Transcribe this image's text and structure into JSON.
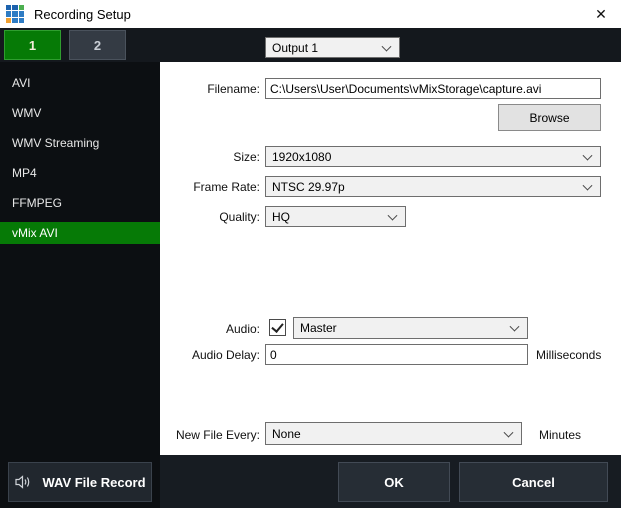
{
  "window": {
    "title": "Recording Setup",
    "close_glyph": "✕"
  },
  "tabs": [
    {
      "label": "1",
      "active": true
    },
    {
      "label": "2",
      "active": false
    }
  ],
  "output_select": {
    "value": "Output 1"
  },
  "sidebar": {
    "items": [
      {
        "label": "AVI",
        "selected": false
      },
      {
        "label": "WMV",
        "selected": false
      },
      {
        "label": "WMV Streaming",
        "selected": false
      },
      {
        "label": "MP4",
        "selected": false
      },
      {
        "label": "FFMPEG",
        "selected": false
      },
      {
        "label": "vMix AVI",
        "selected": true
      }
    ]
  },
  "form": {
    "filename": {
      "label": "Filename:",
      "value": "C:\\Users\\User\\Documents\\vMixStorage\\capture.avi"
    },
    "browse_label": "Browse",
    "size": {
      "label": "Size:",
      "value": "1920x1080"
    },
    "frame_rate": {
      "label": "Frame Rate:",
      "value": "NTSC 29.97p"
    },
    "quality": {
      "label": "Quality:",
      "value": "HQ"
    },
    "audio": {
      "label": "Audio:",
      "checked": true,
      "value": "Master"
    },
    "audio_delay": {
      "label": "Audio Delay:",
      "value": "0",
      "unit": "Milliseconds"
    },
    "new_file_every": {
      "label": "New File Every:",
      "value": "None",
      "unit": "Minutes"
    }
  },
  "footer": {
    "wav_button": "WAV File Record",
    "ok_label": "OK",
    "cancel_label": "Cancel"
  },
  "icons": {
    "app_icon": "vmix-grid-icon",
    "speaker": "speaker-volume-icon",
    "chevron": "chevron-down-icon"
  },
  "colors": {
    "accent_green": "#067a06",
    "accent_green_border": "#2f9e2f",
    "window_bg": "#14181d",
    "sidebar_bg": "#0c0f12",
    "panel_bg": "#ffffff",
    "dark_btn_bg": "#262d35",
    "dark_btn_border": "#424a55"
  }
}
